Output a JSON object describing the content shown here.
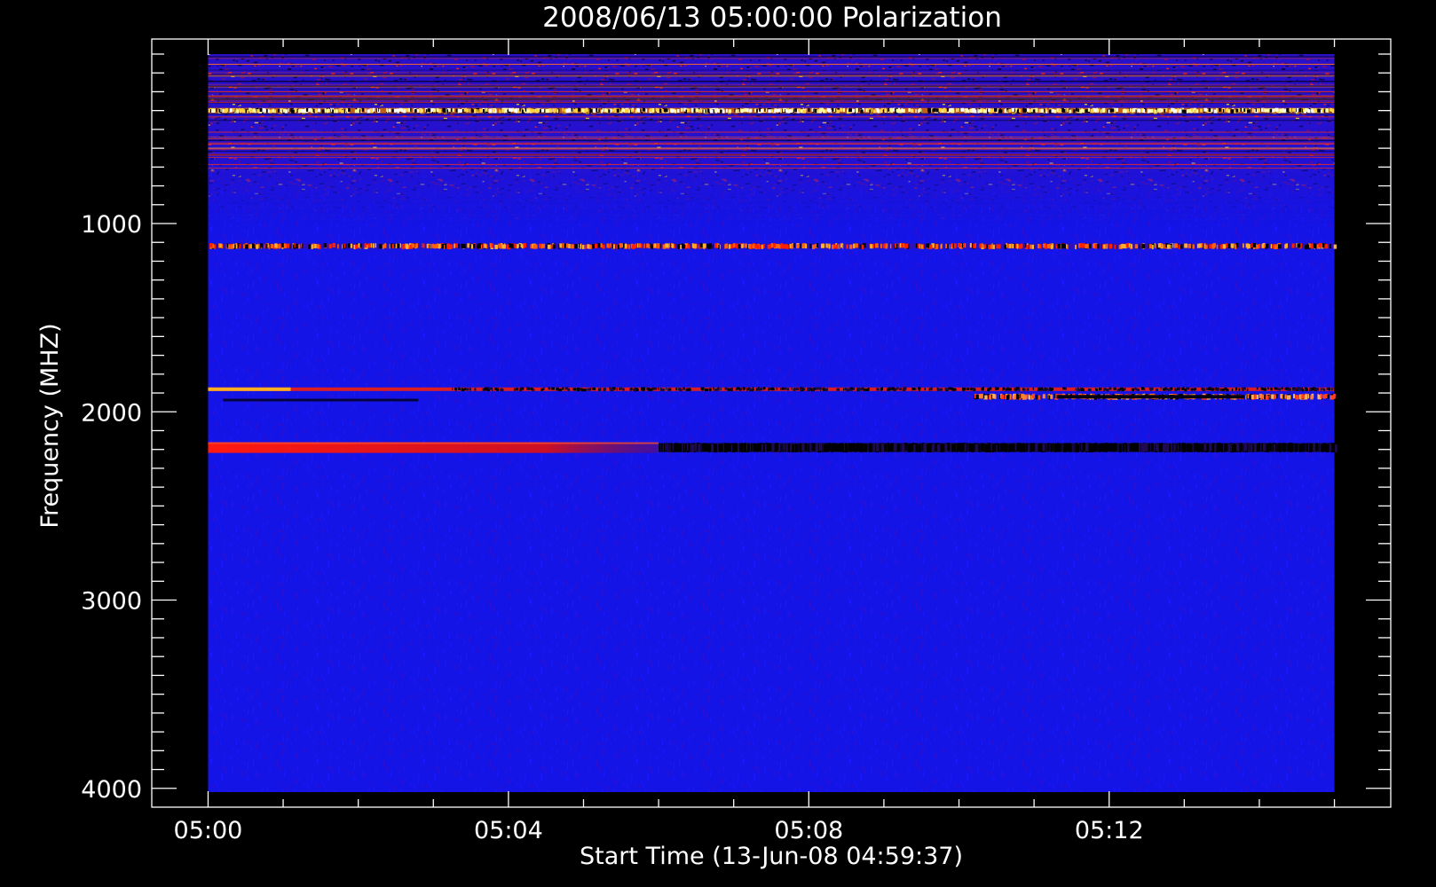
{
  "chart_data": {
    "type": "heatmap",
    "title": "2008/06/13 05:00:00 Polarization",
    "xlabel": "Start Time (13-Jun-08 04:59:37)",
    "ylabel": "Frequency (MHZ)",
    "x_ticks": [
      "05:00",
      "05:04",
      "05:08",
      "05:12"
    ],
    "x_tick_minutes": [
      0,
      4,
      8,
      12
    ],
    "y_ticks": [
      1000,
      2000,
      3000,
      4000
    ],
    "xlim_minutes": [
      -0.75,
      15.75
    ],
    "ylim": [
      4100,
      20
    ],
    "data_extent": {
      "time_minutes": [
        0,
        15
      ],
      "frequency_mhz": [
        100,
        4020
      ]
    },
    "y_axis_inverted": true,
    "colormap": [
      "#000000",
      "#0000ff",
      "#ff0000",
      "#ffff00",
      "#ffffff"
    ],
    "background_color": "#1414e6",
    "features": [
      {
        "name": "low-frequency interference",
        "frequency_mhz": [
          100,
          700
        ],
        "type": "noise"
      },
      {
        "name": "bright line",
        "frequency_mhz": 400,
        "time_minutes": [
          0,
          15
        ],
        "color": "#ffff66"
      },
      {
        "name": "dotted band",
        "frequency_mhz": 1120,
        "time_minutes": [
          0,
          15
        ],
        "color": "#ff8000"
      },
      {
        "name": "narrow line",
        "frequency_mhz": 1880,
        "time_minutes": [
          0,
          15
        ],
        "color": "#ff2000"
      },
      {
        "name": "intermittent line",
        "frequency_mhz": 1920,
        "time_minutes": [
          10.2,
          15
        ],
        "color": "#ff4000"
      },
      {
        "name": "strong band",
        "frequency_mhz": 2190,
        "time_minutes": [
          0,
          6
        ],
        "color": "#ff0000"
      },
      {
        "name": "dark band",
        "frequency_mhz": 2190,
        "time_minutes": [
          6,
          15
        ],
        "color": "#000000"
      }
    ]
  }
}
